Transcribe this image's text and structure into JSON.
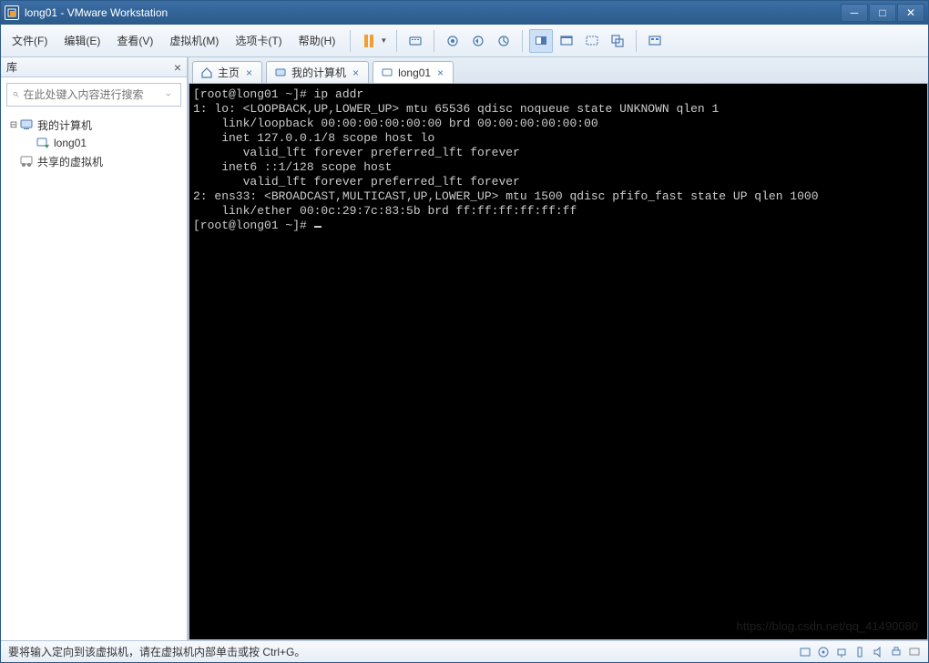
{
  "titlebar": {
    "text": "long01 - VMware Workstation"
  },
  "menu": {
    "file": "文件(F)",
    "edit": "编辑(E)",
    "view": "查看(V)",
    "vm": "虚拟机(M)",
    "tabs": "选项卡(T)",
    "help": "帮助(H)"
  },
  "sidebar": {
    "title": "库",
    "search_placeholder": "在此处键入内容进行搜索",
    "tree": {
      "root": "我的计算机",
      "child1": "long01",
      "shared": "共享的虚拟机"
    }
  },
  "tabs": {
    "home": "主页",
    "mycomputer": "我的计算机",
    "long01": "long01"
  },
  "terminal": {
    "lines": [
      "[root@long01 ~]# ip addr",
      "1: lo: <LOOPBACK,UP,LOWER_UP> mtu 65536 qdisc noqueue state UNKNOWN qlen 1",
      "    link/loopback 00:00:00:00:00:00 brd 00:00:00:00:00:00",
      "    inet 127.0.0.1/8 scope host lo",
      "       valid_lft forever preferred_lft forever",
      "    inet6 ::1/128 scope host ",
      "       valid_lft forever preferred_lft forever",
      "2: ens33: <BROADCAST,MULTICAST,UP,LOWER_UP> mtu 1500 qdisc pfifo_fast state UP qlen 1000",
      "    link/ether 00:0c:29:7c:83:5b brd ff:ff:ff:ff:ff:ff",
      "[root@long01 ~]# "
    ],
    "watermark": "https://blog.csdn.net/qq_41490080"
  },
  "statusbar": {
    "text": "要将输入定向到该虚拟机，请在虚拟机内部单击或按 Ctrl+G。"
  }
}
